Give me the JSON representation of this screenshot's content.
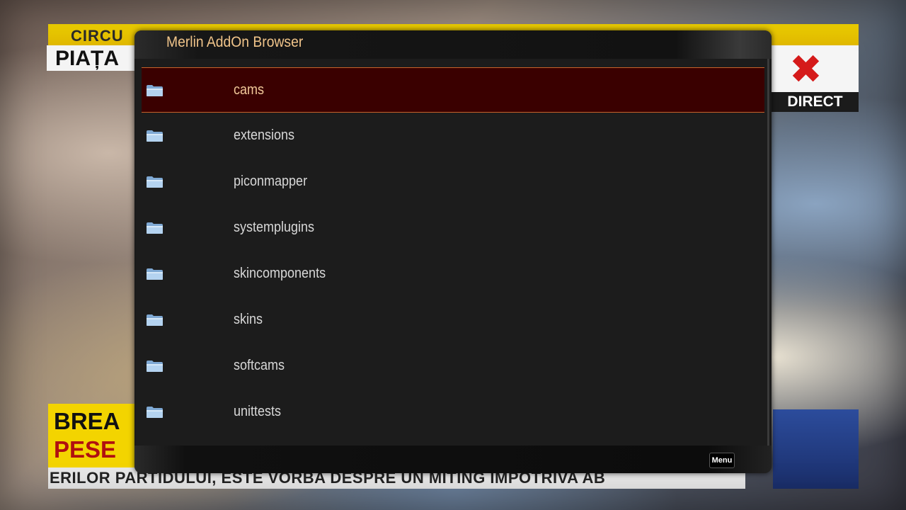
{
  "background": {
    "top_banner": "CIRCU",
    "title_box": "PIAȚA",
    "logo_mark": "✖",
    "direct_label": "DIRECT",
    "breaking_line1": "BREA",
    "breaking_line2": "PESE",
    "ticker": "ERILOR PARTIDULUI, ESTE VORBA DESPRE UN MITING ÎMPOTRIVA AB"
  },
  "dialog": {
    "title": "Merlin AddOn Browser",
    "selected_index": 0,
    "items": [
      {
        "label": "cams",
        "icon": "folder-icon"
      },
      {
        "label": "extensions",
        "icon": "folder-icon"
      },
      {
        "label": "piconmapper",
        "icon": "folder-icon"
      },
      {
        "label": "systemplugins",
        "icon": "folder-icon"
      },
      {
        "label": "skincomponents",
        "icon": "folder-icon"
      },
      {
        "label": "skins",
        "icon": "folder-icon"
      },
      {
        "label": "softcams",
        "icon": "folder-icon"
      },
      {
        "label": "unittests",
        "icon": "folder-icon"
      }
    ],
    "footer": {
      "menu_label": "Menu"
    }
  },
  "colors": {
    "title": "#f0c48a",
    "selection_bg": "#3a0000",
    "selection_border": "#c8622a",
    "item_text": "#d8d8d8",
    "folder": "#9dc2e6"
  }
}
